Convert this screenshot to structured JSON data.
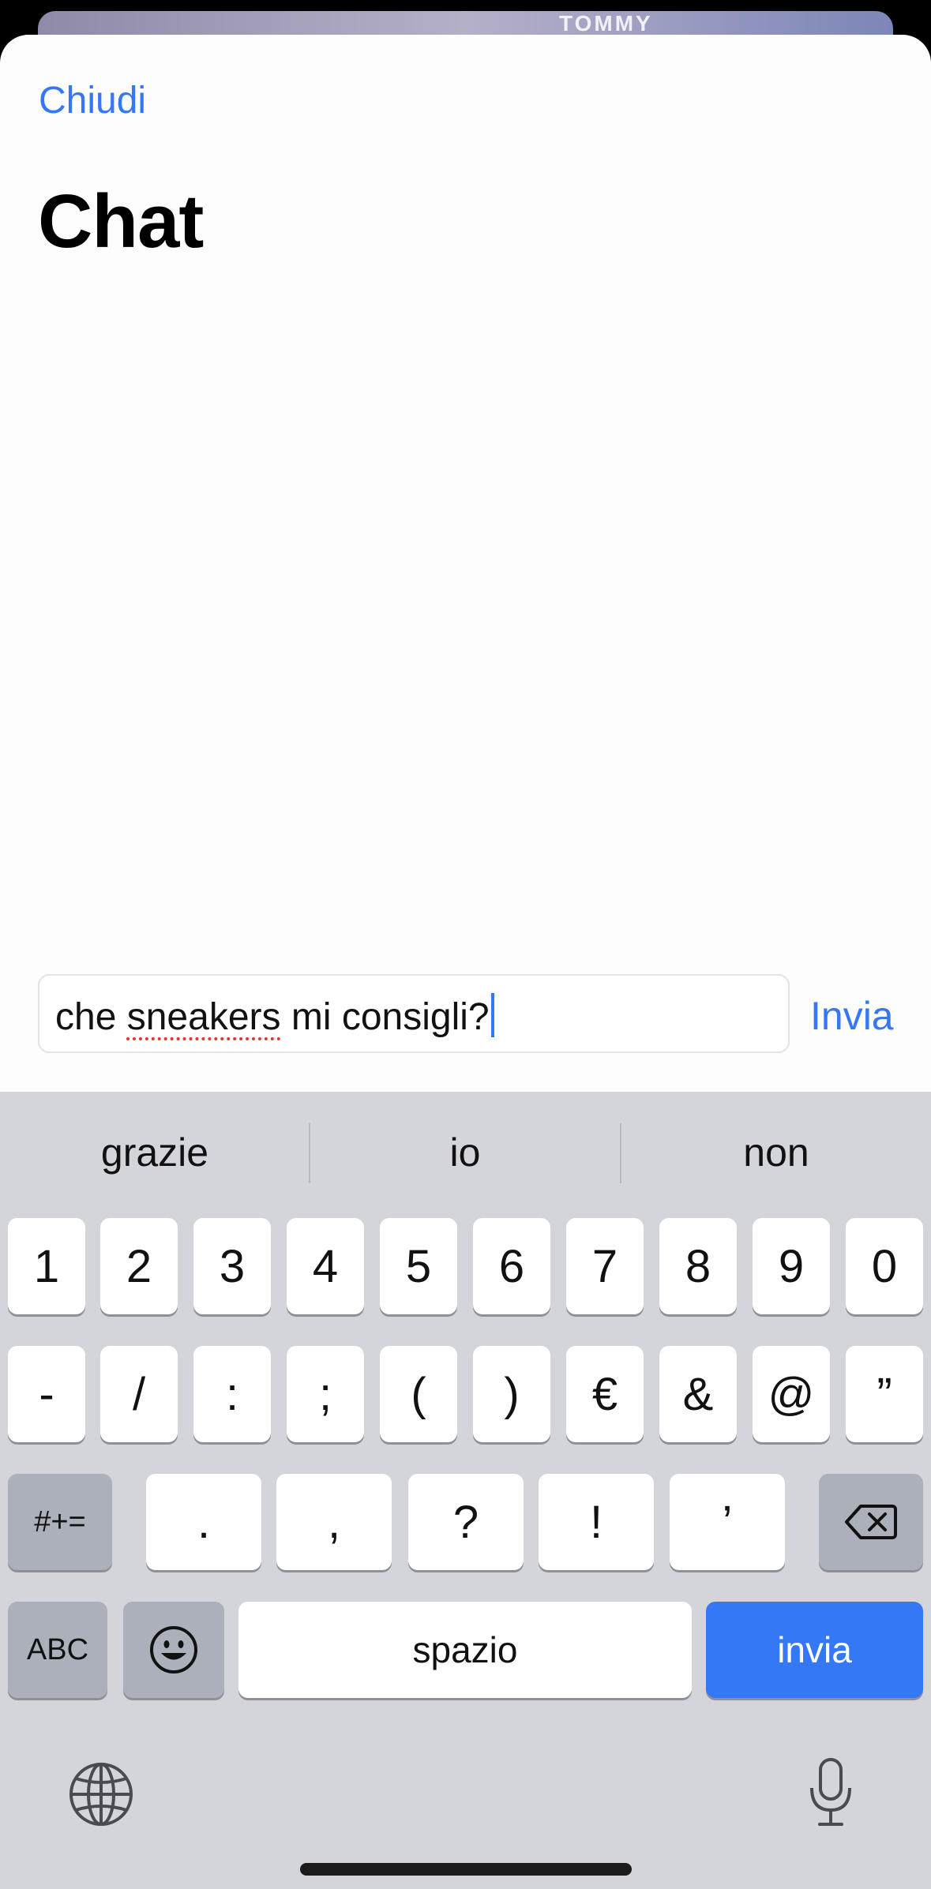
{
  "background": {
    "brand_text": "TOMMY"
  },
  "header": {
    "close_label": "Chiudi",
    "title": "Chat"
  },
  "composer": {
    "text_before": "che ",
    "text_misspelled": "sneakers",
    "text_after": " mi consigli?",
    "send_label": "Invia"
  },
  "keyboard": {
    "suggestions": [
      "grazie",
      "io",
      "non"
    ],
    "row1": [
      "1",
      "2",
      "3",
      "4",
      "5",
      "6",
      "7",
      "8",
      "9",
      "0"
    ],
    "row2": [
      "-",
      "/",
      ":",
      ";",
      "(",
      ")",
      "€",
      "&",
      "@",
      "”"
    ],
    "row3_left": "#+=",
    "row3": [
      ".",
      ",",
      "?",
      "!",
      "’"
    ],
    "abc_label": "ABC",
    "space_label": "spazio",
    "return_label": "invia"
  },
  "colors": {
    "accent": "#3478f6",
    "keyboard_bg": "#d4d5db",
    "key_dark": "#abb0bb"
  },
  "icons": [
    "backspace-icon",
    "emoji-icon",
    "globe-icon",
    "microphone-icon"
  ]
}
